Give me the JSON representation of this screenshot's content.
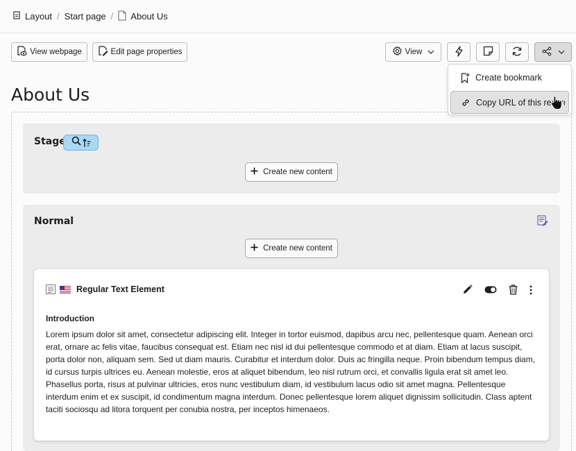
{
  "breadcrumb": {
    "items": [
      "Layout",
      "Start page",
      "About Us"
    ]
  },
  "toolbar": {
    "view_webpage": "View webpage",
    "edit_page_properties": "Edit page properties",
    "view": "View"
  },
  "share_menu": {
    "items": [
      "Create bookmark",
      "Copy URL of this record"
    ]
  },
  "page": {
    "title": "About Us"
  },
  "columns": {
    "stage": {
      "title": "Stage",
      "create_label": "Create new content"
    },
    "normal": {
      "title": "Normal",
      "create_label": "Create new content"
    }
  },
  "content_element": {
    "title": "Regular Text Element",
    "heading": "Introduction",
    "body": "Lorem ipsum dolor sit amet, consectetur adipiscing elit. Integer in tortor euismod, dapibus arcu nec, pellentesque quam. Aenean orci erat, ornare ac felis vitae, faucibus consequat est. Etiam nec nisl id dui pellentesque commodo et at diam. Etiam at lacus suscipit, porta dolor non, aliquam sem. Sed ut diam mauris. Curabitur et interdum dolor. Duis ac fringilla neque. Proin bibendum tempus diam, id cursus turpis ultrices eu. Aenean molestie, eros at aliquet bibendum, leo nisl rutrum orci, et convallis ligula erat sit amet leo. Phasellus porta, risus at pulvinar ultricies, eros nunc vestibulum diam, id vestibulum lacus odio sit amet magna. Pellentesque interdum enim et ex suscipit, id condimentum magna interdum. Donec pellentesque lorem aliquet dignissim sollicitudin. Class aptent taciti sociosqu ad litora torquent per conubia nostra, per inceptos himenaeos."
  },
  "colors": {
    "badge_bg": "#a9d8f3",
    "column_bg": "#ececec",
    "menu_active_bg": "#e2e2e2"
  }
}
